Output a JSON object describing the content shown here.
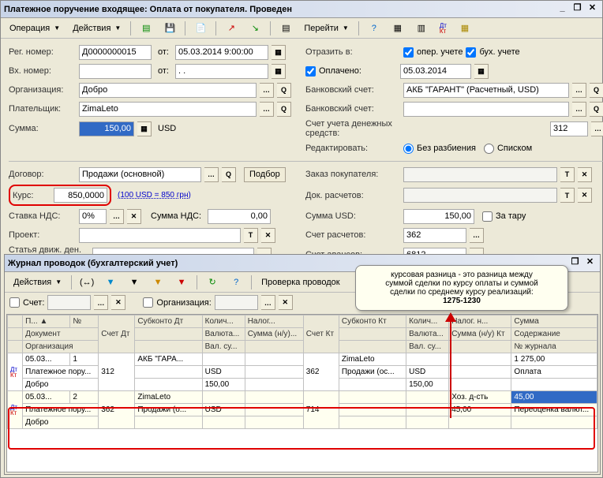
{
  "window": {
    "title": "Платежное поручение входящее: Оплата от покупателя. Проведен",
    "minimize": "_",
    "restore": "❐",
    "close": "✕"
  },
  "toolbar": {
    "operation": "Операция",
    "actions": "Действия",
    "goto": "Перейти"
  },
  "form": {
    "reg_number_lbl": "Рег. номер:",
    "reg_number": "Д0000000015",
    "from_lbl": "от:",
    "reg_date": "05.03.2014  9:00:00",
    "in_number_lbl": "Вх. номер:",
    "in_number": "",
    "in_date": " . .",
    "organization_lbl": "Организация:",
    "organization": "Добро",
    "payer_lbl": "Плательщик:",
    "payer": "ZimaLeto",
    "sum_lbl": "Сумма:",
    "sum": "150,00",
    "currency": "USD",
    "reflect_lbl": "Отразить в:",
    "oper_chk": "опер. учете",
    "bux_chk": "бух. учете",
    "paid_chk": "Оплачено:",
    "paid_date": "05.03.2014",
    "bank_acc_lbl": "Банковский счет:",
    "bank_acc": "АКБ \"ГАРАНТ\" (Расчетный, USD)",
    "bank_acc2": "",
    "money_acc_lbl": "Счет учета денежных средств:",
    "money_acc": "312",
    "edit_lbl": "Редактировать:",
    "radio_nosplit": "Без разбиения",
    "radio_list": "Списком",
    "contract_lbl": "Договор:",
    "contract": "Продажи (основной)",
    "podbor": "Подбор",
    "order_lbl": "Заказ покупателя:",
    "doc_rasch_lbl": "Док. расчетов:",
    "rate_lbl": "Курс:",
    "rate": "850,0000",
    "rate_calc": "(100 USD = 850 грн)",
    "vat_lbl": "Ставка НДС:",
    "vat": "0%",
    "vat_sum_lbl": "Сумма НДС:",
    "vat_sum": "0,00",
    "sum_usd_lbl": "Сумма USD:",
    "sum_usd": "150,00",
    "za_taru": "За тару",
    "project_lbl": "Проект:",
    "settle_acc_lbl": "Счет расчетов:",
    "settle_acc": "362",
    "movement_lbl": "Статья движ. ден. средств:",
    "advance_acc_lbl": "Счет авансов:",
    "advance_acc": "6812"
  },
  "journal": {
    "title": "Журнал проводок (бухгалтерский учет)",
    "actions": "Действия",
    "check": "Проверка проводок",
    "filter_acc_lbl": "Счет:",
    "filter_org_lbl": "Организация:"
  },
  "grid": {
    "hdr": {
      "period": "П...",
      "num": "№",
      "acc_dt": "Счет Дт",
      "sub_dt": "Субконто Дт",
      "qty": "Колич...",
      "tax": "Налог...",
      "acc_kt": "Счет Кт",
      "sub_kt": "Субконто Кт",
      "qty2": "Колич...",
      "tax2": "Налог. н...",
      "sum": "Сумма",
      "doc": "Документ",
      "val_dt": "Валюта...",
      "sum_nu": "Сумма (н/у)...",
      "val_kt": "Валюта...",
      "sum_nu_kt": "Сумма (н/у) Кт",
      "content": "Содержание",
      "org": "Организация",
      "val_su": "Вал. су...",
      "val_su2": "Вал. су...",
      "journal_no": "№ журнала",
      "mark": "▲"
    },
    "rows": [
      {
        "date": "05.03...",
        "n": "1",
        "acc_dt": "312",
        "sub_dt": "АКБ \"ГАРА...",
        "acc_kt": "362",
        "sub_kt": "ZimaLeto",
        "sum": "1 275,00",
        "doc": "Платежное пору...",
        "val_dt": "USD",
        "sub_kt2": "Продажи (ос...",
        "val_kt": "USD",
        "content": "Оплата",
        "org": "Добро",
        "val_su_dt": "150,00",
        "val_su_kt": "150,00"
      },
      {
        "date": "05.03...",
        "n": "2",
        "acc_dt": "362",
        "sub_dt": "ZimaLeto",
        "acc_kt": "714",
        "tax2": "Хоз. д-сть",
        "sum": "45,00",
        "doc": "Платежное пору...",
        "sub_dt2": "Продажи (о...",
        "val_dt": "USD",
        "sum_nu_kt": "45,00",
        "content": "Переоценка валют...",
        "org": "Добро"
      }
    ]
  },
  "callout": {
    "text1": "курсовая разница - это разница между",
    "text2": "суммой сделки по курсу оплаты и суммой",
    "text3": "сделки по среднему курсу реализаций:",
    "text4": "1275-1230"
  }
}
